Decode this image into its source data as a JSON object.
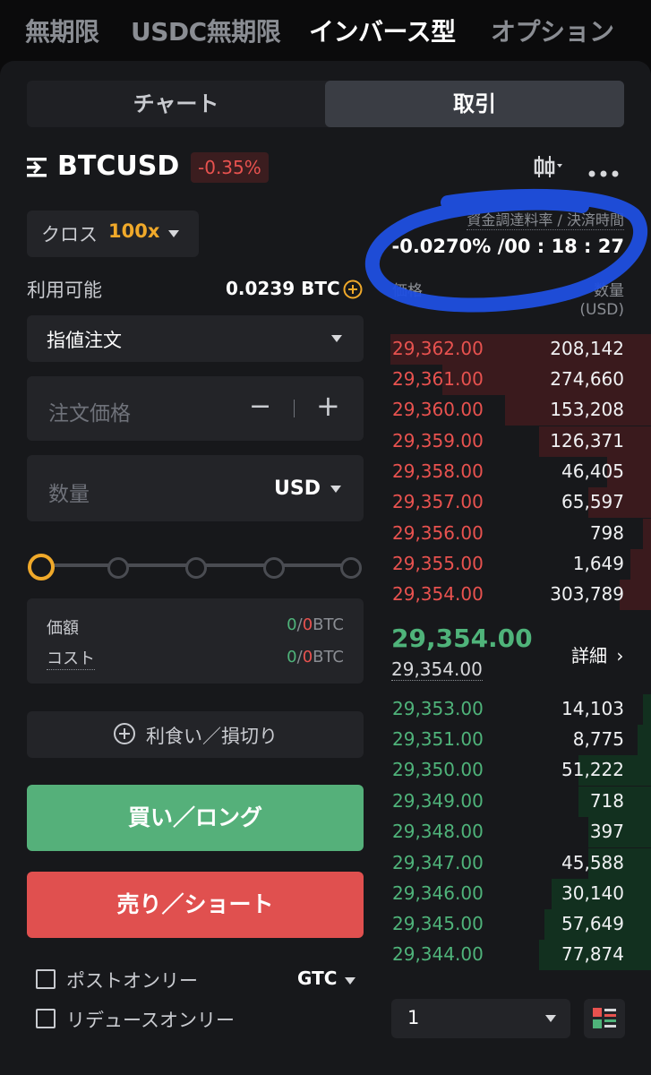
{
  "top_tabs": [
    "無期限",
    "USDC無期限",
    "インバース型",
    "オプション"
  ],
  "segment": {
    "chart": "チャート",
    "trade": "取引"
  },
  "symbol": {
    "name": "BTCUSD",
    "change": "-0.35%"
  },
  "funding": {
    "label": "資金調達料率 / 決済時間",
    "value": "-0.0270% /00 : 18 : 27"
  },
  "margin": {
    "mode": "クロス",
    "leverage": "100x"
  },
  "available": {
    "label": "利用可能",
    "value": "0.0239 BTC"
  },
  "order_type": "指値注文",
  "price_input": {
    "placeholder": "注文価格",
    "minus": "−",
    "plus": "+"
  },
  "qty_input": {
    "placeholder": "数量",
    "unit": "USD"
  },
  "summary": {
    "value_label": "価額",
    "value_green": "0",
    "value_sep": "/",
    "value_red": "0",
    "value_unit": "BTC",
    "cost_label": "コスト",
    "cost_green": "0",
    "cost_sep": "/",
    "cost_red": "0",
    "cost_unit": "BTC"
  },
  "tpsl_label": "利食い／損切り",
  "buy_label": "買い／ロング",
  "sell_label": "売り／ショート",
  "post_only": "ポストオンリー",
  "reduce_only": "リデュースオンリー",
  "tif": "GTC",
  "orderbook": {
    "price_header": "価格",
    "qty_header": "数量",
    "qty_unit": "(USD)",
    "asks": [
      {
        "price": "29,362.00",
        "qty": "208,142",
        "depth": 1.0
      },
      {
        "price": "29,361.00",
        "qty": "274,660",
        "depth": 0.8
      },
      {
        "price": "29,360.00",
        "qty": "153,208",
        "depth": 0.56
      },
      {
        "price": "29,359.00",
        "qty": "126,371",
        "depth": 0.43
      },
      {
        "price": "29,358.00",
        "qty": "46,405",
        "depth": 0.17
      },
      {
        "price": "29,357.00",
        "qty": "65,597",
        "depth": 0.24
      },
      {
        "price": "29,356.00",
        "qty": "798",
        "depth": 0.03
      },
      {
        "price": "29,355.00",
        "qty": "1,649",
        "depth": 0.08
      },
      {
        "price": "29,354.00",
        "qty": "303,789",
        "depth": 0.12
      }
    ],
    "last_price": "29,354.00",
    "mark_price": "29,354.00",
    "detail_label": "詳細",
    "bids": [
      {
        "price": "29,353.00",
        "qty": "14,103",
        "depth": 0.03
      },
      {
        "price": "29,351.00",
        "qty": "8,775",
        "depth": 0.05
      },
      {
        "price": "29,350.00",
        "qty": "51,222",
        "depth": 0.28
      },
      {
        "price": "29,349.00",
        "qty": "718",
        "depth": 0.28
      },
      {
        "price": "29,348.00",
        "qty": "397",
        "depth": 0.24
      },
      {
        "price": "29,347.00",
        "qty": "45,588",
        "depth": 0.24
      },
      {
        "price": "29,346.00",
        "qty": "30,140",
        "depth": 0.38
      },
      {
        "price": "29,345.00",
        "qty": "57,649",
        "depth": 0.41
      },
      {
        "price": "29,344.00",
        "qty": "77,874",
        "depth": 0.43
      }
    ],
    "precision": "1"
  },
  "colors": {
    "ask": "#e8524f",
    "bid": "#4fb37a",
    "ask_bar": "#3a1a1d",
    "bid_bar": "#12301f",
    "accent": "#f0a92a",
    "annotation": "#1f4fe0"
  }
}
